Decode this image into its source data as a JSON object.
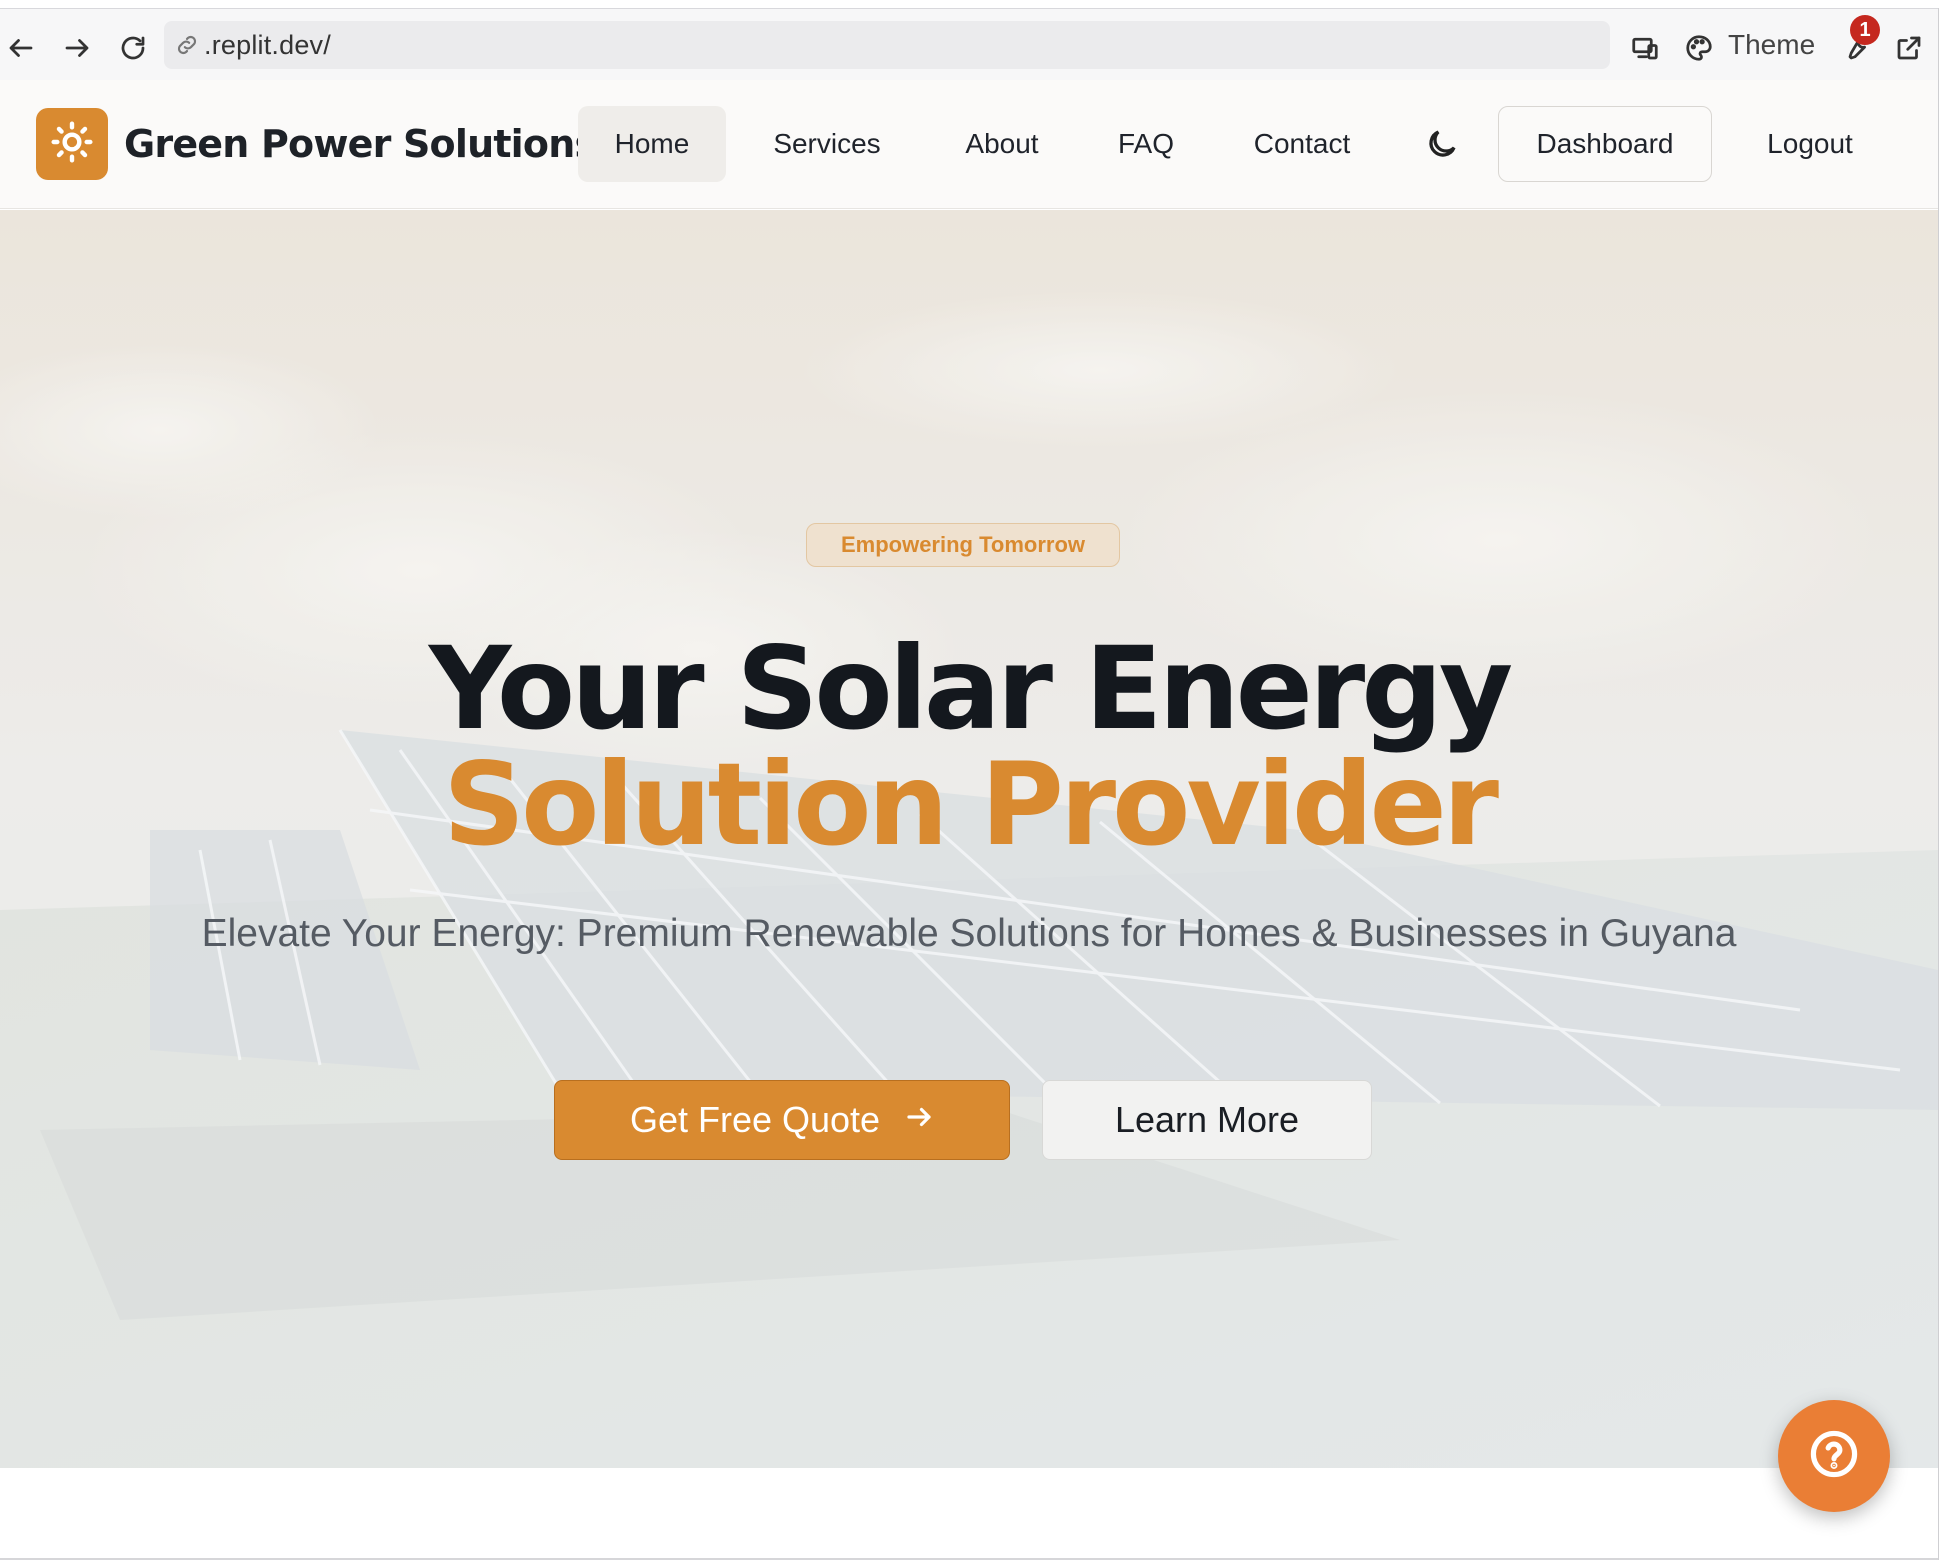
{
  "browser": {
    "url": ".replit.dev/",
    "theme_label": "Theme",
    "notification_count": "1"
  },
  "site": {
    "brand": "Green Power Solutions",
    "nav": {
      "home": "Home",
      "services": "Services",
      "about": "About",
      "faq": "FAQ",
      "contact": "Contact",
      "dashboard": "Dashboard",
      "logout": "Logout"
    },
    "accent_color": "#d98a30"
  },
  "hero": {
    "tag": "Empowering Tomorrow",
    "title_line1": "Your Solar Energy",
    "title_line2": "Solution Provider",
    "subtitle": "Elevate Your Energy: Premium Renewable Solutions for Homes & Businesses in Guyana",
    "primary_cta": "Get Free Quote",
    "secondary_cta": "Learn More"
  },
  "icons": {
    "back": "arrow-left-icon",
    "forward": "arrow-right-icon",
    "reload": "reload-icon",
    "link": "link-icon",
    "devices": "devices-icon",
    "palette": "palette-icon",
    "wrench": "wrench-icon",
    "external": "external-link-icon",
    "logo": "sun-icon",
    "theme_toggle": "moon-icon",
    "cta_arrow": "arrow-right-icon",
    "help": "help-circle-icon"
  }
}
